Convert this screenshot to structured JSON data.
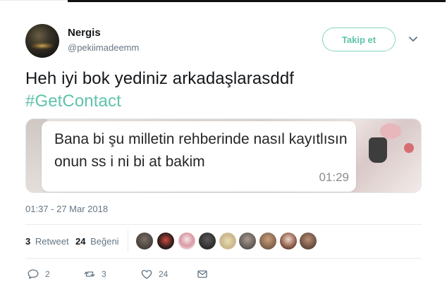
{
  "user": {
    "display_name": "Nergis",
    "handle": "@pekiimadeemm"
  },
  "follow_button": {
    "label": "Takip et"
  },
  "tweet": {
    "text": "Heh iyi bok yediniz arkadaşlarasddf",
    "hashtag": "#GetContact",
    "timestamp": "01:37 - 27 Mar 2018"
  },
  "media": {
    "message": "Bana bi şu milletin rehberinde nasıl kayıtlısın onun ss i ni bi at bakim",
    "time": "01:29"
  },
  "stats": {
    "retweet_count": "3",
    "retweet_label": "Retweet",
    "like_count": "24",
    "like_label": "Beğeni"
  },
  "actions": {
    "reply_count": "2",
    "retweet_count": "3",
    "like_count": "24"
  },
  "colors": {
    "accent": "#5fc3ab",
    "secondary_text": "#657786"
  },
  "icons": [
    "chevron-down-icon",
    "reply-icon",
    "retweet-icon",
    "heart-icon",
    "message-icon"
  ]
}
